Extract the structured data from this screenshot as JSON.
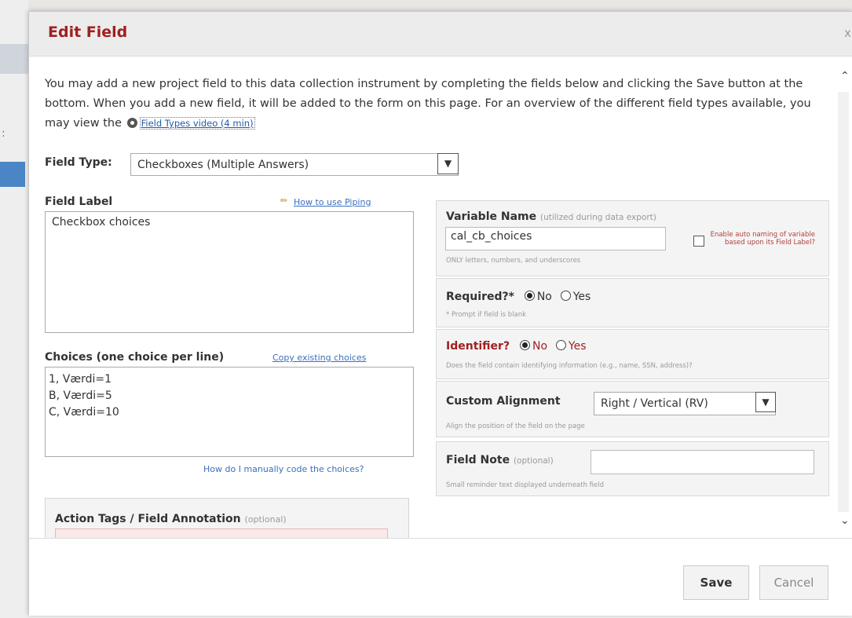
{
  "modal": {
    "title": "Edit Field",
    "close": "x",
    "intro_text": "You may add a new project field to this data collection instrument by completing the fields below and clicking the Save button at the bottom. When you add a new field, it will be added to the form on this page. For an overview of the different field types available, you may view the",
    "intro_link": "Field Types video (4 min)"
  },
  "field_type": {
    "label": "Field Type:",
    "value": "Checkboxes (Multiple Answers)"
  },
  "field_label": {
    "label": "Field Label",
    "piping_link": "How to use Piping",
    "value": "Checkbox choices"
  },
  "choices": {
    "label": "Choices (one choice per line)",
    "copy_link": "Copy existing choices",
    "lines": [
      "1, Værdi=1",
      "B, Værdi=5",
      "C, Værdi=10"
    ],
    "manual_link": "How do I manually code the choices?"
  },
  "action_tags": {
    "label": "Action Tags / Field Annotation",
    "optional": "(optional)"
  },
  "variable_name": {
    "label": "Variable Name",
    "sub": "(utilized during data export)",
    "value": "cal_cb_choices",
    "hint": "ONLY letters, numbers, and underscores",
    "autoname": "Enable auto naming of variable based upon its Field Label?"
  },
  "required": {
    "label": "Required?*",
    "no": "No",
    "yes": "Yes",
    "hint": "* Prompt if field is blank"
  },
  "identifier": {
    "label": "Identifier?",
    "no": "No",
    "yes": "Yes",
    "hint": "Does the field contain identifying information (e.g., name, SSN, address)?"
  },
  "alignment": {
    "label": "Custom Alignment",
    "value": "Right / Vertical (RV)",
    "hint": "Align the position of the field on the page"
  },
  "field_note": {
    "label": "Field Note",
    "optional": "(optional)",
    "value": "",
    "hint": "Small reminder text displayed underneath field"
  },
  "footer": {
    "save": "Save",
    "cancel": "Cancel"
  },
  "colors": {
    "title_red": "#a02020",
    "link_blue": "#3a6fbf",
    "annotation_bg": "#fbe9e9"
  },
  "icons": {
    "film": "film-reel-icon",
    "pencil": "pencil-icon",
    "dropdown": "chevron-down-icon"
  }
}
